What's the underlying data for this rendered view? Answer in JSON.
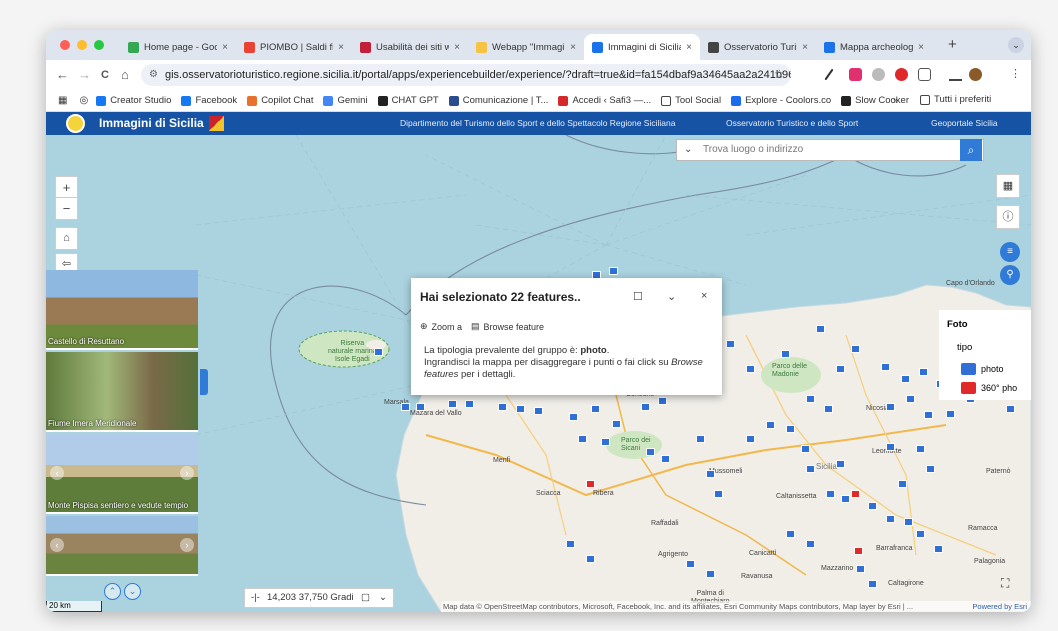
{
  "browser": {
    "tabs": [
      {
        "label": "Home page - Goo",
        "color": "#34a853"
      },
      {
        "label": "PIOMBO | Saldi fin",
        "color": "#ea4335"
      },
      {
        "label": "Usabilità dei siti w",
        "color": "#c41e3a"
      },
      {
        "label": "Webapp \"Immagini",
        "color": "#f6c343"
      },
      {
        "label": "Immagini di Sicilia",
        "color": "#1a73e8"
      },
      {
        "label": "Osservatorio Turis",
        "color": "#444444"
      },
      {
        "label": "Mappa archeologic",
        "color": "#1a73e8"
      }
    ],
    "tab_close": "×",
    "new_tab": "+",
    "tab_menu": "⌄",
    "url": "gis.osservatorioturistico.regione.sicilia.it/portal/apps/experiencebuilder/experience/?draft=true&id=fa154dbaf9a34645aa2a241b96c68f...",
    "nav": {
      "back": "←",
      "forward": "→",
      "reload": "C",
      "home": "⌂"
    },
    "bookmarks": [
      {
        "label": "Creator Studio",
        "color": "#1877f2"
      },
      {
        "label": "Facebook",
        "color": "#1877f2"
      },
      {
        "label": "Copilot Chat",
        "color": "#e86f2c"
      },
      {
        "label": "Gemini",
        "color": "#4285f4"
      },
      {
        "label": "CHAT GPT",
        "color": "#222222"
      },
      {
        "label": "Comunicazione | T...",
        "color": "#2a4d8f"
      },
      {
        "label": "Accedi ‹ Safi3 —...",
        "color": "#d62828"
      },
      {
        "label": "Tool Social",
        "color": "#ffffff"
      },
      {
        "label": "Explore - Coolors.co",
        "color": "#1a6cf0"
      },
      {
        "label": "Slow Cooker",
        "color": "#222222"
      }
    ],
    "bookmarks_more": "»",
    "all_bookmarks": "Tutti i preferiti"
  },
  "app": {
    "title": "Immagini di Sicilia",
    "header_links": [
      "Dipartimento del Turismo dello Sport e dello Spettacolo Regione Siciliana",
      "Osservatorio Turistico e dello Sport",
      "Geoportale Sicilia"
    ],
    "colors": {
      "header": "#1653a4",
      "accent": "#2f7bd7",
      "water": "#aad3df",
      "land": "#f1eee8"
    }
  },
  "map": {
    "search_placeholder": "Trova luogo o indirizzo",
    "zoom_in": "+",
    "zoom_out": "−",
    "scale": "20 km",
    "coords": "14,203 37,750 Gradi",
    "attribution": "Map data © OpenStreetMap contributors, Microsoft, Facebook, Inc. and its affiliates, Esri Community Maps contributors, Map layer by Esri | ...",
    "powered_by": "Powered by Esri",
    "labels": [
      "Riserva naturale marina Isole Egadi",
      "Mazara del Vallo",
      "Marsala",
      "Menfi",
      "Sciacca",
      "Ribera",
      "Agrigento",
      "Raffadali",
      "Caltanissetta",
      "Sicilia",
      "Mussomeli",
      "Leonforte",
      "Paternò",
      "Ramacca",
      "Palagonia",
      "Barrafranca",
      "Mazzarino",
      "Caltagirone",
      "Ravanusa",
      "Canicattì",
      "Palma di Montechiaro",
      "Capo d'Orlando",
      "Nicosia",
      "Corleone",
      "Parco dei Sicani",
      "Piano delle Madonie"
    ]
  },
  "photos": [
    {
      "caption": "Castello di Resuttano"
    },
    {
      "caption": "Fiume Imera Meridionale"
    },
    {
      "caption": "Monte Pispisa sentiero e vedute tempio"
    },
    {
      "caption": ""
    }
  ],
  "popup": {
    "title": "Hai selezionato 22 features..",
    "zoom_label": "Zoom a",
    "browse_label": "Browse feature",
    "line1_prefix": "La tipologia prevalente del gruppo è: ",
    "line1_bold": "photo",
    "line1_suffix": ".",
    "line2_prefix": "Ingrandisci la mappa per disaggregare i punti o fai click su ",
    "line2_italic": "Browse features",
    "line2_suffix": " per i dettagli."
  },
  "legend": {
    "title": "Foto",
    "subtitle": "tipo",
    "items": [
      {
        "label": "photo",
        "color": "#2f6fd6"
      },
      {
        "label": "360° pho",
        "color": "#e02a2a"
      }
    ]
  }
}
